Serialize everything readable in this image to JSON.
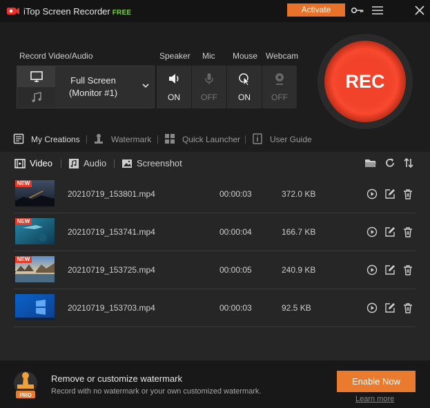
{
  "titlebar": {
    "app_name": "iTop Screen Recorder",
    "edition": "FREE",
    "activate_label": "Activate",
    "icons": [
      "app-logo-icon",
      "key-icon",
      "menu-icon",
      "close-icon"
    ]
  },
  "record": {
    "section_label": "Record Video/Audio",
    "source_line1": "Full Screen",
    "source_line2": "(Monitor #1)",
    "toggles": [
      {
        "label": "Speaker",
        "state": "ON",
        "icon": "speaker-icon"
      },
      {
        "label": "Mic",
        "state": "OFF",
        "icon": "mic-icon"
      },
      {
        "label": "Mouse",
        "state": "ON",
        "icon": "mouse-cursor-icon"
      },
      {
        "label": "Webcam",
        "state": "OFF",
        "icon": "webcam-icon"
      }
    ],
    "rec_label": "REC"
  },
  "nav": [
    {
      "label": "My Creations",
      "icon": "creations-icon",
      "active": true
    },
    {
      "label": "Watermark",
      "icon": "watermark-icon",
      "active": false
    },
    {
      "label": "Quick Launcher",
      "icon": "quick-launcher-icon",
      "active": false
    },
    {
      "label": "User Guide",
      "icon": "user-guide-icon",
      "active": false
    }
  ],
  "tabs": [
    {
      "label": "Video",
      "icon": "video-icon",
      "active": true
    },
    {
      "label": "Audio",
      "icon": "audio-icon",
      "active": false
    },
    {
      "label": "Screenshot",
      "icon": "screenshot-icon",
      "active": false
    }
  ],
  "files": [
    {
      "name": "20210719_153801.mp4",
      "duration": "00:00:03",
      "size": "372.0 KB",
      "new": "NEW"
    },
    {
      "name": "20210719_153741.mp4",
      "duration": "00:00:04",
      "size": "166.7 KB",
      "new": "NEW"
    },
    {
      "name": "20210719_153725.mp4",
      "duration": "00:00:05",
      "size": "240.9 KB",
      "new": "NEW"
    },
    {
      "name": "20210719_153703.mp4",
      "duration": "00:00:03",
      "size": "92.5 KB",
      "new": ""
    }
  ],
  "promo": {
    "badge": "PRO",
    "title": "Remove or customize watermark",
    "subtitle": "Record with no watermark or your own customized watermark.",
    "enable_label": "Enable Now",
    "learn_label": "Learn more"
  },
  "colors": {
    "accent": "#e9722a",
    "rec": "#f2432a",
    "free": "#7ad13a",
    "new_badge": "#e23b2a"
  }
}
